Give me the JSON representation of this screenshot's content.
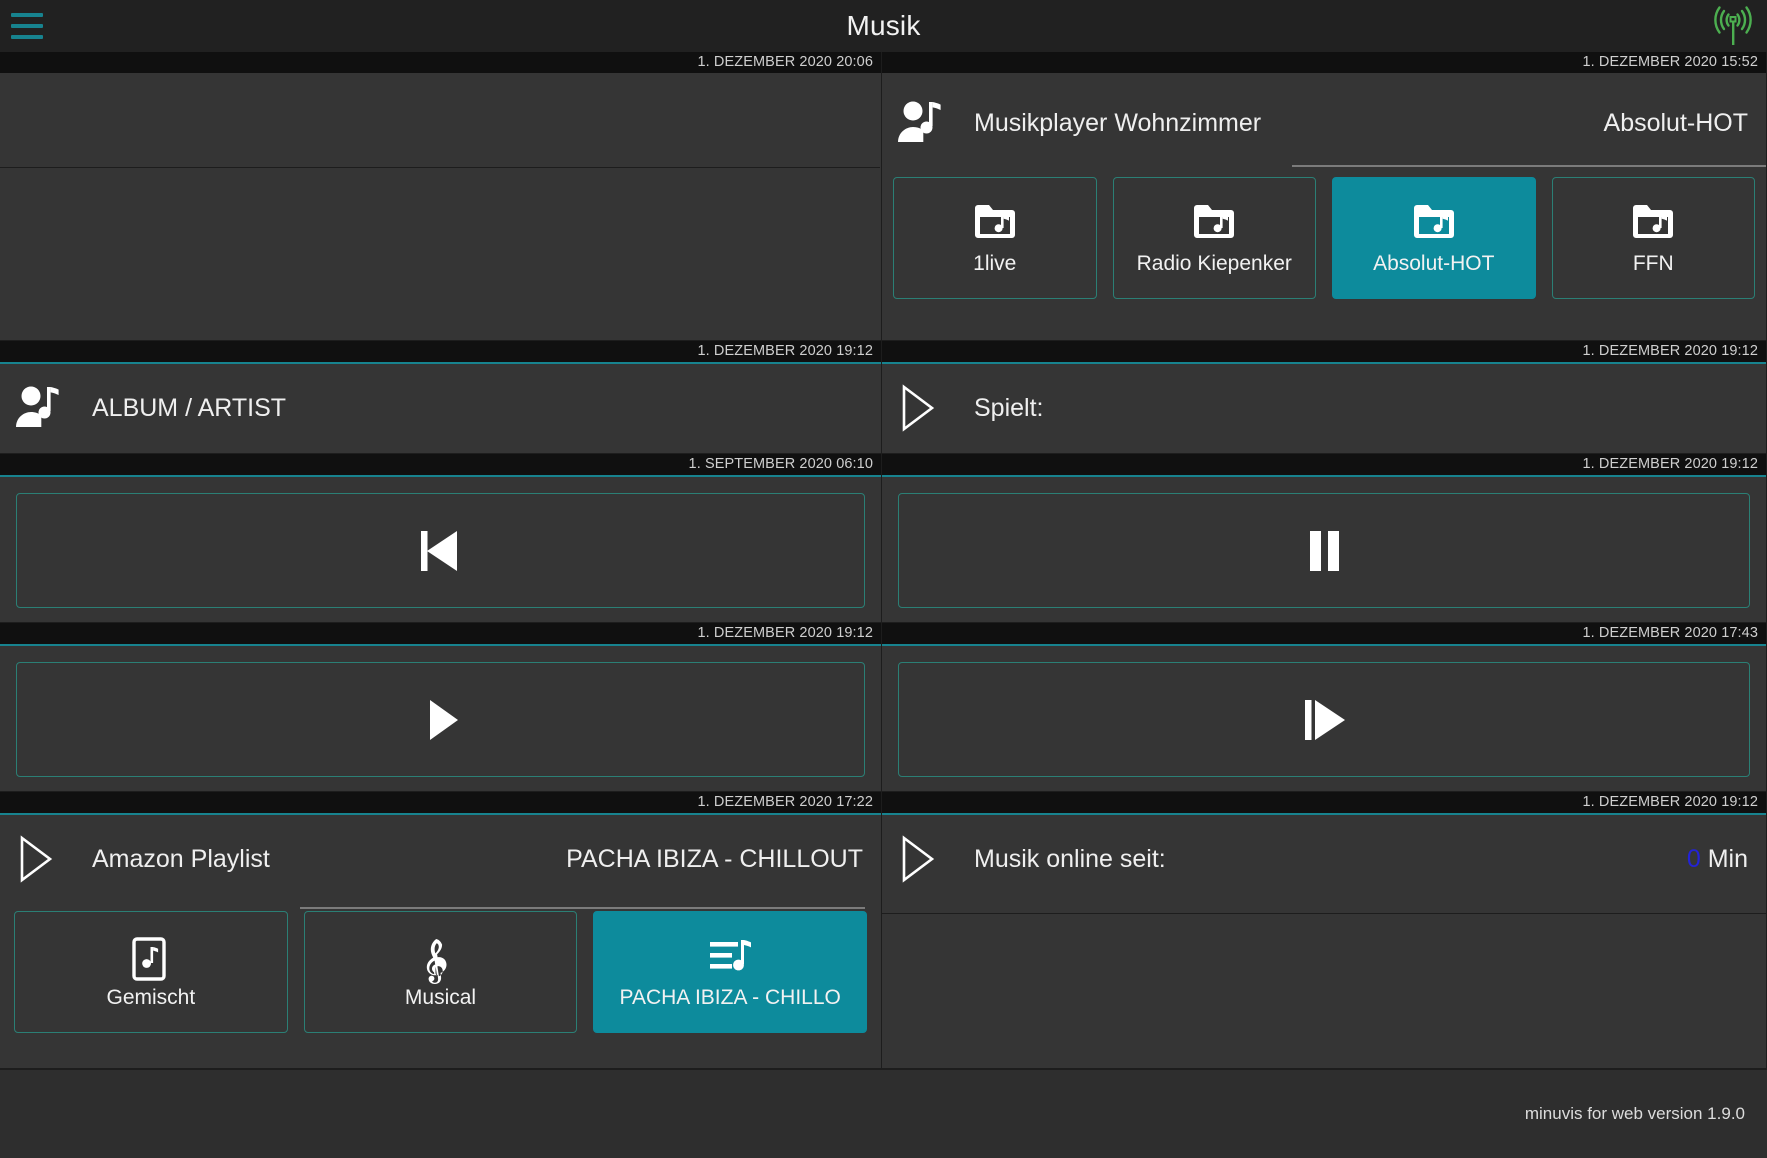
{
  "topbar": {
    "menu_icon": "hamburger-icon",
    "title": "Musik",
    "status_icon": "broadcast-antenna-icon"
  },
  "colors": {
    "accent": "#0d8b9c",
    "tile_border": "#2b7f75",
    "panel_bg": "#353535",
    "stamp_bg": "#101010",
    "antenna": "#4caf50",
    "number_blue": "#2323d6"
  },
  "panels": {
    "blank_top_left": {
      "timestamp": "1. DEZEMBER 2020 20:06"
    },
    "player": {
      "timestamp": "1. DEZEMBER 2020 15:52",
      "icon": "person-music-icon",
      "title": "Musikplayer Wohnzimmer",
      "value": "Absolut-HOT",
      "stations": [
        {
          "label": "1live",
          "icon": "folder-music-icon",
          "active": false
        },
        {
          "label": "Radio Kiepenker",
          "icon": "folder-music-icon",
          "active": false
        },
        {
          "label": "Absolut-HOT",
          "icon": "folder-music-icon",
          "active": true
        },
        {
          "label": "FFN",
          "icon": "folder-music-icon",
          "active": false
        }
      ]
    },
    "album_artist": {
      "timestamp": "1. DEZEMBER 2020 19:12",
      "icon": "person-music-icon",
      "title": "ALBUM / ARTIST",
      "value": ""
    },
    "spielt": {
      "timestamp": "1. DEZEMBER 2020 19:12",
      "icon": "play-outline-icon",
      "title": "Spielt:",
      "value": ""
    },
    "prev_button": {
      "timestamp": "1. SEPTEMBER 2020 06:10",
      "icon": "previous-track-icon"
    },
    "pause_button": {
      "timestamp": "1. DEZEMBER 2020 19:12",
      "icon": "pause-icon"
    },
    "play_button": {
      "timestamp": "1. DEZEMBER 2020 19:12",
      "icon": "play-icon"
    },
    "next_button": {
      "timestamp": "1. DEZEMBER 2020 17:43",
      "icon": "next-track-icon"
    },
    "amazon_playlist": {
      "timestamp": "1. DEZEMBER 2020 17:22",
      "icon": "play-outline-icon",
      "title": "Amazon Playlist",
      "value": "PACHA IBIZA - CHILLOUT",
      "playlists": [
        {
          "label": "Gemischt",
          "icon": "music-note-box-icon",
          "active": false
        },
        {
          "label": "Musical",
          "icon": "treble-clef-icon",
          "active": false
        },
        {
          "label": "PACHA IBIZA - CHILLO",
          "icon": "playlist-note-icon",
          "active": true
        }
      ]
    },
    "online_seit": {
      "timestamp": "1. DEZEMBER 2020 19:12",
      "icon": "play-outline-icon",
      "title": "Musik online seit:",
      "value_number": "0",
      "value_unit": " Min"
    },
    "blank_bottom_right": {
      "timestamp": ""
    }
  },
  "footer": {
    "text": "minuvis for web version 1.9.0"
  }
}
